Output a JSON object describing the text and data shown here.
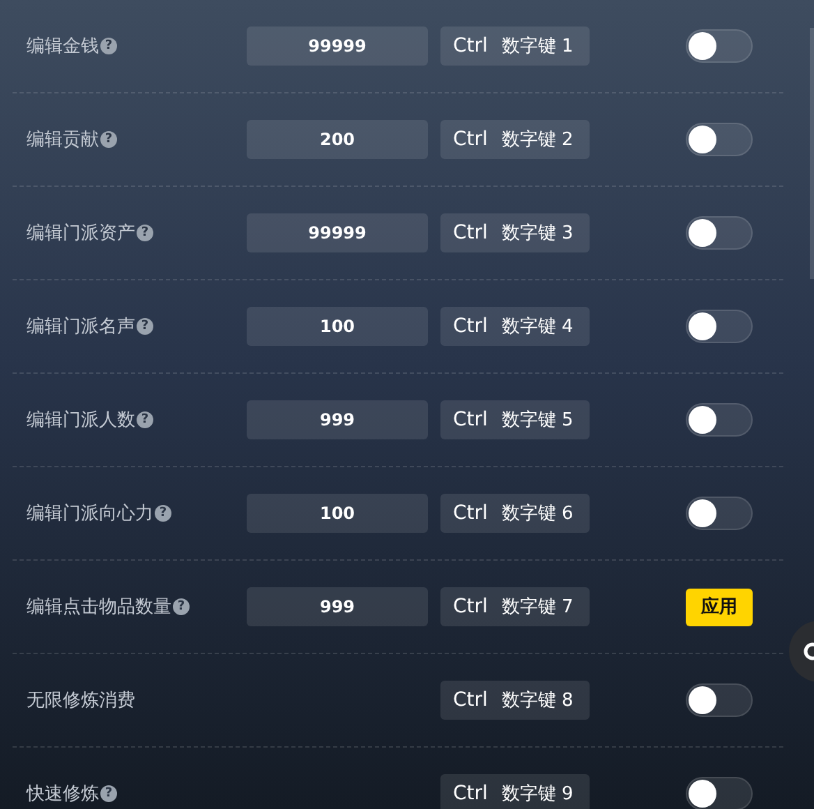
{
  "rows": [
    {
      "label": "编辑金钱",
      "help": "?",
      "value": "99999",
      "modifier": "Ctrl",
      "key": "数字键 1",
      "kind": "toggle",
      "on": false
    },
    {
      "label": "编辑贡献",
      "help": "?",
      "value": "200",
      "modifier": "Ctrl",
      "key": "数字键 2",
      "kind": "toggle",
      "on": false
    },
    {
      "label": "编辑门派资产",
      "help": "?",
      "value": "99999",
      "modifier": "Ctrl",
      "key": "数字键 3",
      "kind": "toggle",
      "on": false
    },
    {
      "label": "编辑门派名声",
      "help": "?",
      "value": "100",
      "modifier": "Ctrl",
      "key": "数字键 4",
      "kind": "toggle",
      "on": false
    },
    {
      "label": "编辑门派人数",
      "help": "?",
      "value": "999",
      "modifier": "Ctrl",
      "key": "数字键 5",
      "kind": "toggle",
      "on": false
    },
    {
      "label": "编辑门派向心力",
      "help": "?",
      "value": "100",
      "modifier": "Ctrl",
      "key": "数字键 6",
      "kind": "toggle",
      "on": false
    },
    {
      "label": "编辑点击物品数量",
      "help": "?",
      "value": "999",
      "modifier": "Ctrl",
      "key": "数字键 7",
      "kind": "button",
      "button": "应用"
    },
    {
      "label": "无限修炼消费",
      "modifier": "Ctrl",
      "key": "数字键 8",
      "kind": "toggle",
      "on": false
    },
    {
      "label": "快速修炼",
      "help": "?",
      "modifier": "Ctrl",
      "key": "数字键 9",
      "kind": "toggle",
      "on": false
    }
  ]
}
